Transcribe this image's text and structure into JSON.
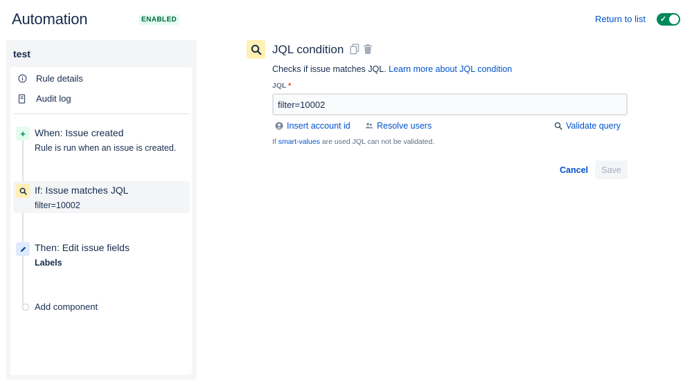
{
  "header": {
    "title": "Automation",
    "status_badge": "ENABLED",
    "return_link": "Return to list",
    "toggle_state": "on"
  },
  "sidebar": {
    "rule_name": "test",
    "menu": [
      {
        "label": "Rule details",
        "icon": "info-icon"
      },
      {
        "label": "Audit log",
        "icon": "document-icon"
      }
    ],
    "steps": [
      {
        "title": "When: Issue created",
        "subtitle": "Rule is run when an issue is created.",
        "icon": "plus-icon",
        "color": "#e3fcef"
      },
      {
        "title": "If: Issue matches JQL",
        "subtitle": "filter=10002",
        "icon": "search-icon",
        "color": "#fff0b3",
        "selected": true
      },
      {
        "title": "Then: Edit issue fields",
        "subtitle": "Labels",
        "icon": "pencil-icon",
        "color": "#deebff"
      }
    ],
    "add_component": "Add component"
  },
  "condition": {
    "title": "JQL condition",
    "description": "Checks if issue matches JQL.",
    "learn_more": "Learn more about JQL condition",
    "jql_label": "JQL",
    "required_marker": "*",
    "jql_value": "filter=10002",
    "insert_account": "Insert account id",
    "resolve_users": "Resolve users",
    "validate_query": "Validate query",
    "hint_prefix": "If",
    "hint_link": "smart-values",
    "hint_suffix": "are used JQL can not be validated.",
    "cancel": "Cancel",
    "save": "Save"
  },
  "colors": {
    "accent": "#0052cc",
    "enabled_green": "#00875a",
    "condition_yellow": "#fff0b3"
  }
}
